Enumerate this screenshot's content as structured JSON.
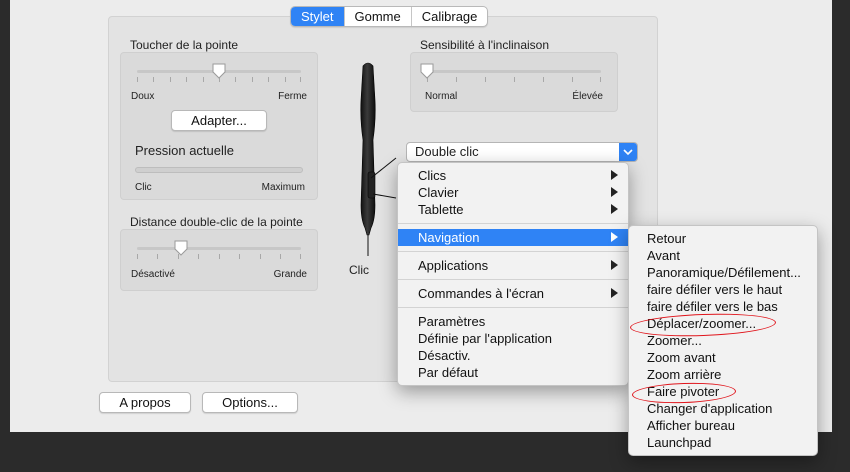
{
  "tabs": [
    {
      "label": "Stylet",
      "active": true
    },
    {
      "label": "Gomme",
      "active": false
    },
    {
      "label": "Calibrage",
      "active": false
    }
  ],
  "tip_feel": {
    "title": "Toucher de la pointe",
    "min_label": "Doux",
    "max_label": "Ferme",
    "level": 0.5,
    "adapt_button": "Adapter...",
    "current_pressure_label": "Pression actuelle",
    "pressure_min": "Clic",
    "pressure_max": "Maximum"
  },
  "double_click": {
    "title": "Distance double-clic de la pointe",
    "min_label": "Désactivé",
    "max_label": "Grande",
    "level": 0.27
  },
  "tilt": {
    "title": "Sensibilité à l'inclinaison",
    "min_label": "Normal",
    "max_label": "Élevée",
    "level": 0.0
  },
  "pen": {
    "tip_label": "Clic"
  },
  "dropdown": {
    "value": "Double clic"
  },
  "menu": {
    "groups": [
      [
        {
          "label": "Clics",
          "submenu": true
        },
        {
          "label": "Clavier",
          "submenu": true
        },
        {
          "label": "Tablette",
          "submenu": true
        }
      ],
      [
        {
          "label": "Navigation",
          "submenu": true,
          "highlighted": true
        }
      ],
      [
        {
          "label": "Applications",
          "submenu": true
        }
      ],
      [
        {
          "label": "Commandes à l'écran",
          "submenu": true
        }
      ],
      [
        {
          "label": "Paramètres"
        },
        {
          "label": "Définie par l'application"
        },
        {
          "label": "Désactiv."
        },
        {
          "label": "Par défaut"
        }
      ]
    ]
  },
  "submenu": {
    "items": [
      "Retour",
      "Avant",
      "Panoramique/Défilement...",
      "faire défiler vers le haut",
      "faire défiler vers le bas",
      "Déplacer/zoomer...",
      "Zoomer...",
      "Zoom avant",
      "Zoom arrière",
      "Faire pivoter",
      "Changer d'application",
      "Afficher bureau",
      "Launchpad"
    ]
  },
  "footer": {
    "about_button": "A propos",
    "options_button": "Options..."
  },
  "colors": {
    "accent": "#2f83f5",
    "annotation": "#e0141b"
  }
}
